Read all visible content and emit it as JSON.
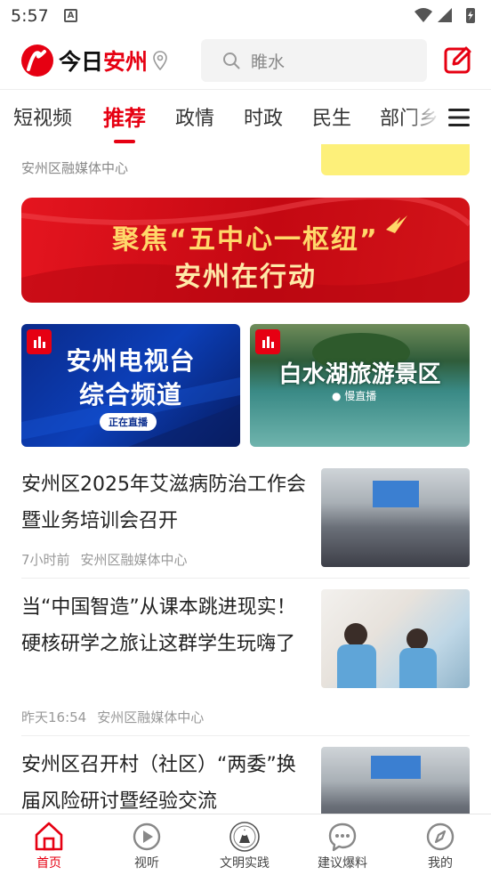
{
  "status_bar": {
    "time": "5:57",
    "notif_glyph": "A"
  },
  "header": {
    "logo_part1": "今日",
    "logo_part2": "安州",
    "search_placeholder": "睢水",
    "brand_color": "#e60012"
  },
  "tabs": {
    "items": [
      {
        "label": "短视频"
      },
      {
        "label": "推荐"
      },
      {
        "label": "政情"
      },
      {
        "label": "时政"
      },
      {
        "label": "民生"
      },
      {
        "label": "部门乡"
      }
    ],
    "active_index": 1
  },
  "feed": {
    "previous_item": {
      "source": "安州区融媒体中心"
    },
    "banner": {
      "line1": "聚焦“五中心一枢纽”",
      "line2": "安州在行动"
    },
    "cards": [
      {
        "line1": "安州电视台",
        "line2": "综合频道",
        "live_label": "正在直播"
      },
      {
        "title": "白水湖旅游景区",
        "sub": "● 慢直播"
      }
    ],
    "news": [
      {
        "title": "安州区2025年艾滋病防治工作会暨业务培训会召开",
        "time": "7小时前",
        "source": "安州区融媒体中心"
      },
      {
        "title": "当“中国智造”从课本跳进现实！硬核研学之旅让这群学生玩嗨了",
        "time": "昨天16:54",
        "source": "安州区融媒体中心"
      },
      {
        "title": "安州区召开村（社区）“两委”换届风险研讨暨经验交流",
        "time": "",
        "source": ""
      }
    ]
  },
  "bottom_nav": {
    "items": [
      {
        "label": "首页",
        "icon": "home-icon"
      },
      {
        "label": "视听",
        "icon": "play-icon"
      },
      {
        "label": "文明实践",
        "icon": "emblem-icon"
      },
      {
        "label": "建议爆料",
        "icon": "chat-icon"
      },
      {
        "label": "我的",
        "icon": "compass-icon"
      }
    ],
    "active_index": 0
  }
}
